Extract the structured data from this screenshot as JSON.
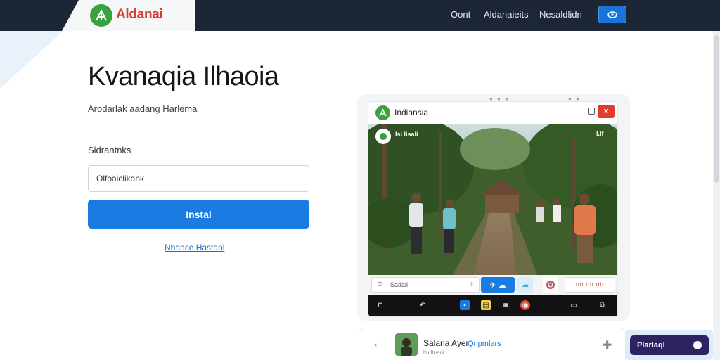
{
  "brand": {
    "name": "Aldanai",
    "logo_icon": "leaf-icon"
  },
  "nav": {
    "links": [
      "Oont",
      "Aldanaieits",
      "Nesaldlidn"
    ],
    "action_icon": "eye-icon"
  },
  "login": {
    "title": "Kvanaqia Ilhaoia",
    "subtitle": "Arodarlak aadang Harlema",
    "field_label": "Sidrantnks",
    "field_value": "Olfoaiclikank",
    "install_label": "Instal",
    "link_label": "Nbance Hastanl"
  },
  "tablet": {
    "app_title": "Indiansia",
    "photo_label": "Isi lisali",
    "photo_label_right": "l.lf",
    "search_text": "Sadail",
    "chip_text": "IIlI IIlI IIlI"
  },
  "bottom": {
    "user_name": "Salarla Ayer",
    "user_tag": "Qnpmlars",
    "user_sub": "ltu ltuanl",
    "cta_label": "Plarlaql"
  },
  "colors": {
    "topbar": "#1c2634",
    "accent_blue": "#1a7be3",
    "brand_green": "#3aa142",
    "brand_red": "#d73a2e",
    "cta_dark": "#2b2460"
  }
}
